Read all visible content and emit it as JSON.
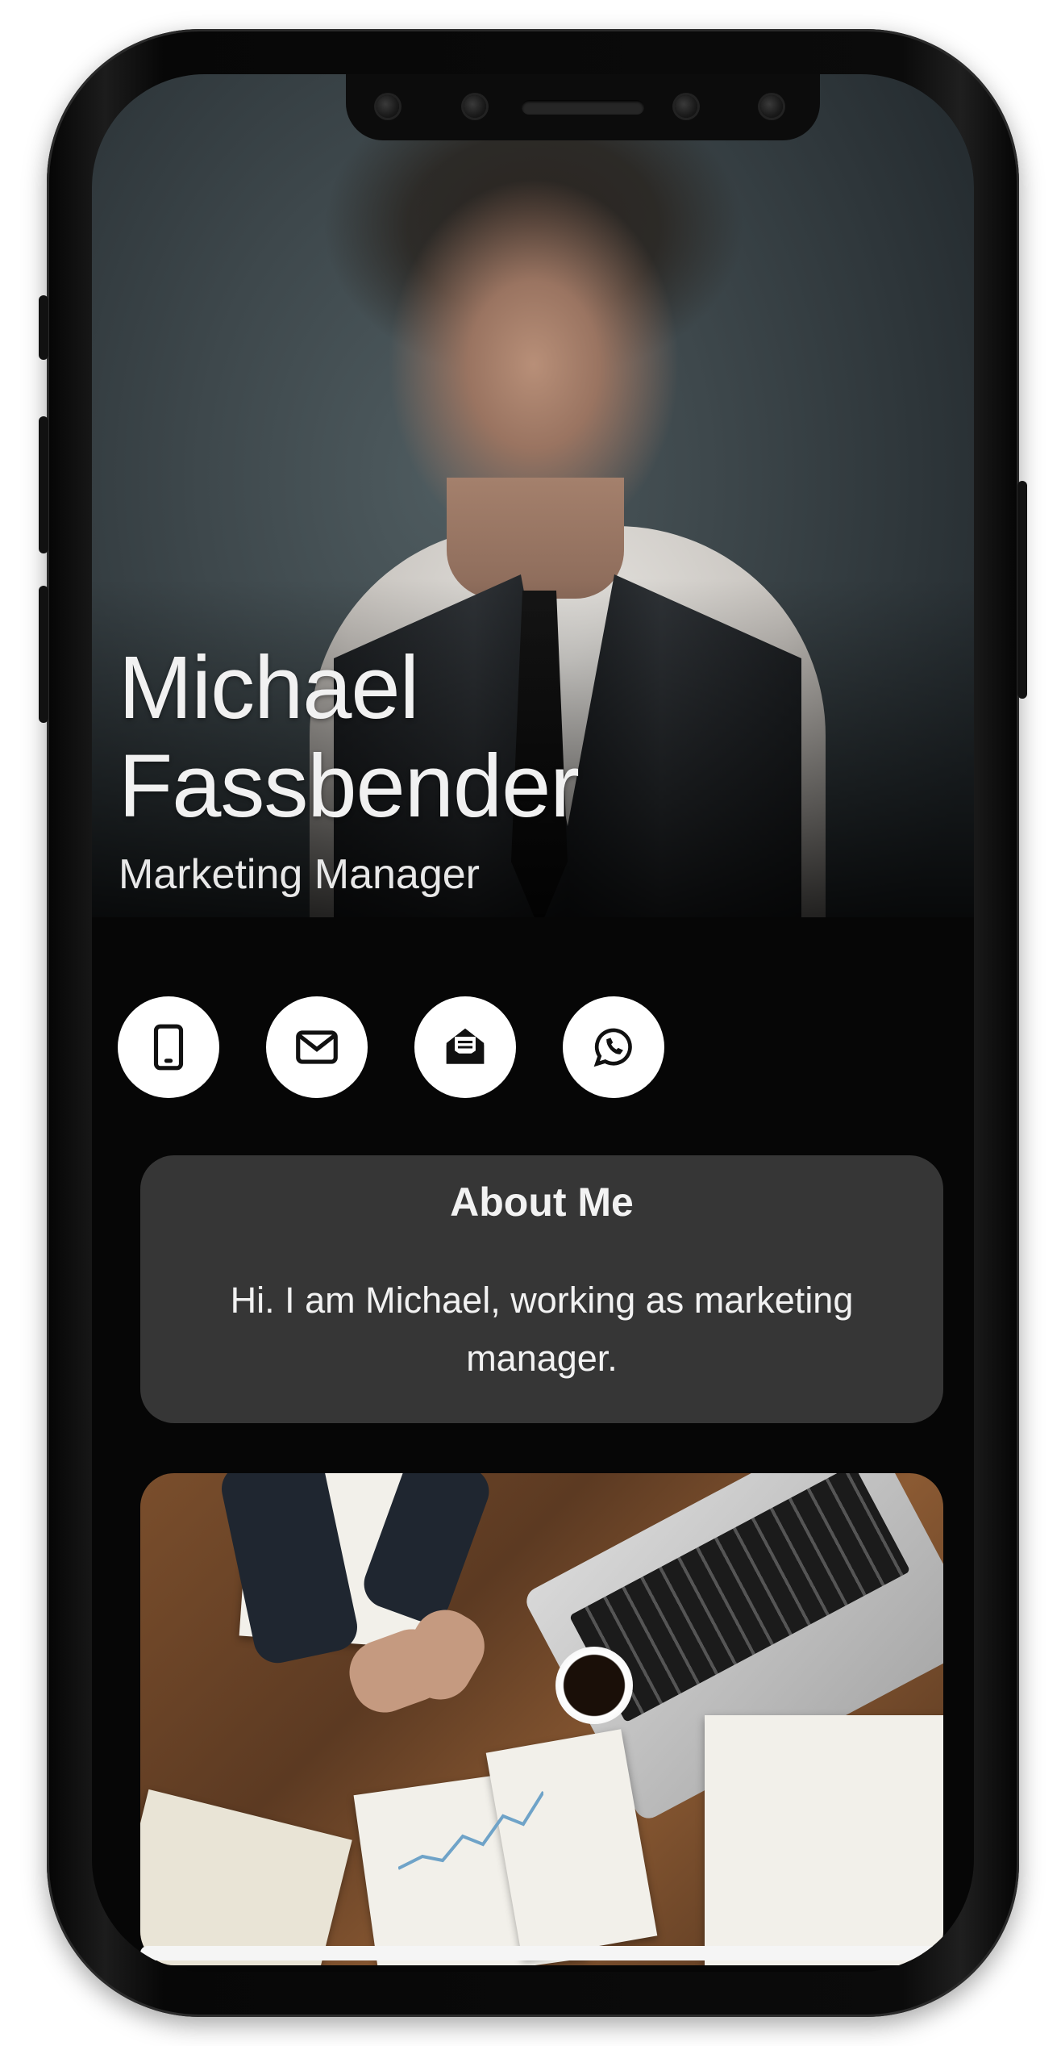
{
  "profile": {
    "first_name": "Michael",
    "last_name": "Fassbender",
    "job_title": "Marketing Manager"
  },
  "actions": [
    {
      "id": "phone",
      "icon": "smartphone-icon"
    },
    {
      "id": "email",
      "icon": "envelope-icon"
    },
    {
      "id": "open-mail",
      "icon": "open-envelope-icon"
    },
    {
      "id": "whatsapp",
      "icon": "whatsapp-icon"
    }
  ],
  "about": {
    "heading": "About Me",
    "text": "Hi. I am Michael, working as marketing manager."
  },
  "colors": {
    "background": "#060606",
    "card": "#363636",
    "text": "#f2f2f2",
    "button": "#ffffff"
  }
}
